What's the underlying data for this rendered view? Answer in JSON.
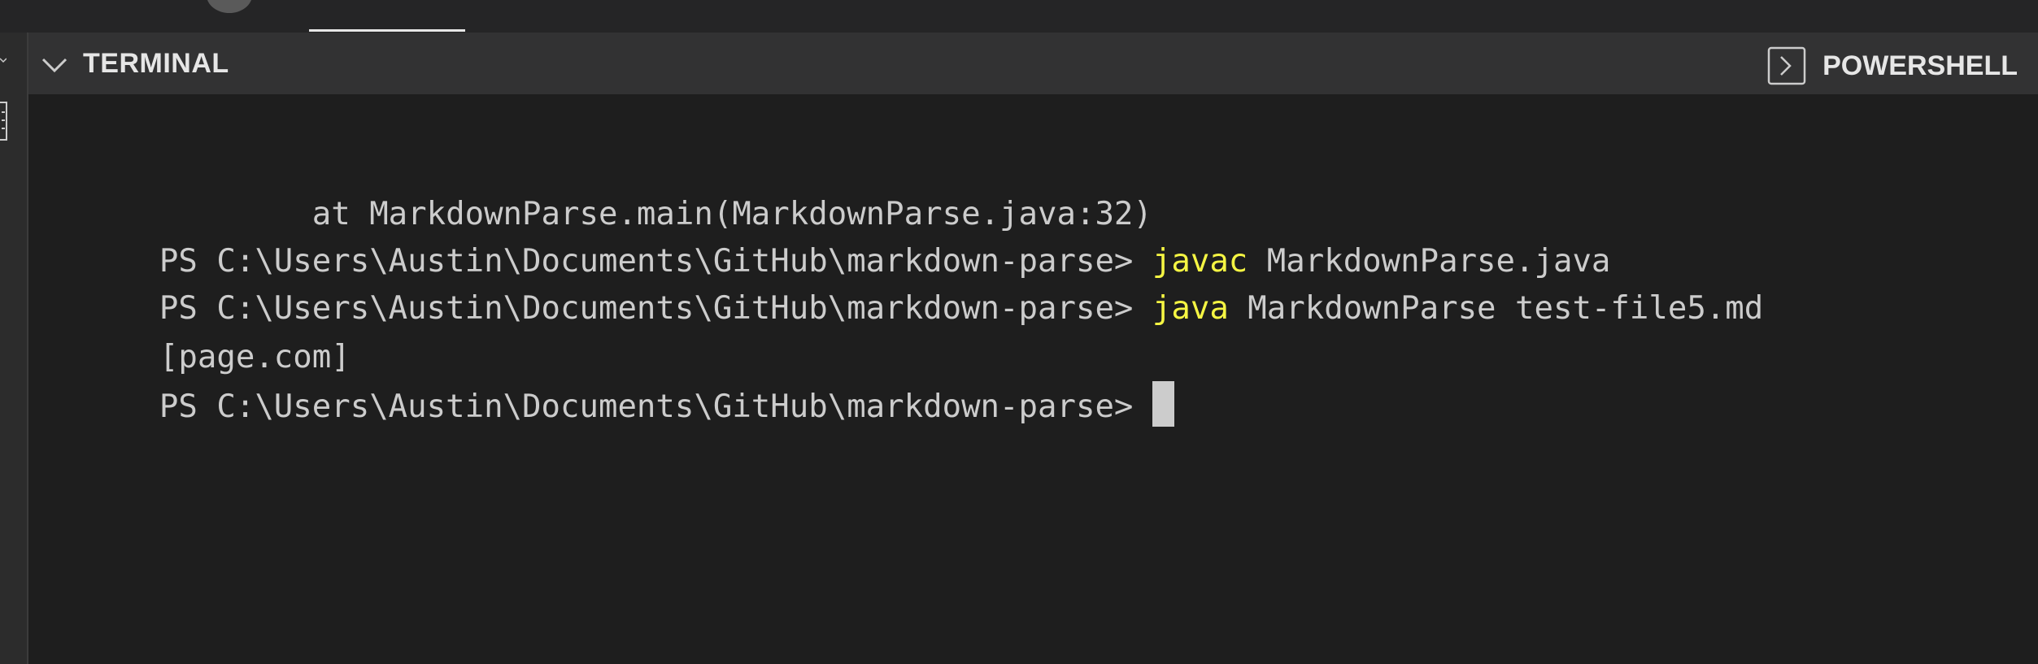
{
  "panel": {
    "title": "TERMINAL",
    "shell_label": "POWERSHELL"
  },
  "terminal": {
    "lines": [
      {
        "text": "        at MarkdownParse.main(MarkdownParse.java:32)"
      },
      {
        "prompt": "PS C:\\Users\\Austin\\Documents\\GitHub\\markdown-parse> ",
        "command": "javac",
        "args": " MarkdownParse.java"
      },
      {
        "prompt": "PS C:\\Users\\Austin\\Documents\\GitHub\\markdown-parse> ",
        "command": "java",
        "args": " MarkdownParse test-file5.md"
      },
      {
        "text": "[page.com]"
      },
      {
        "prompt": "PS C:\\Users\\Austin\\Documents\\GitHub\\markdown-parse> "
      }
    ]
  },
  "colors": {
    "background": "#1e1e1e",
    "header_background": "#323233",
    "text": "#cccccc",
    "command_highlight": "#f5f543"
  },
  "icons": {
    "collapse": "chevron-down-icon",
    "shell": "terminal-icon"
  }
}
